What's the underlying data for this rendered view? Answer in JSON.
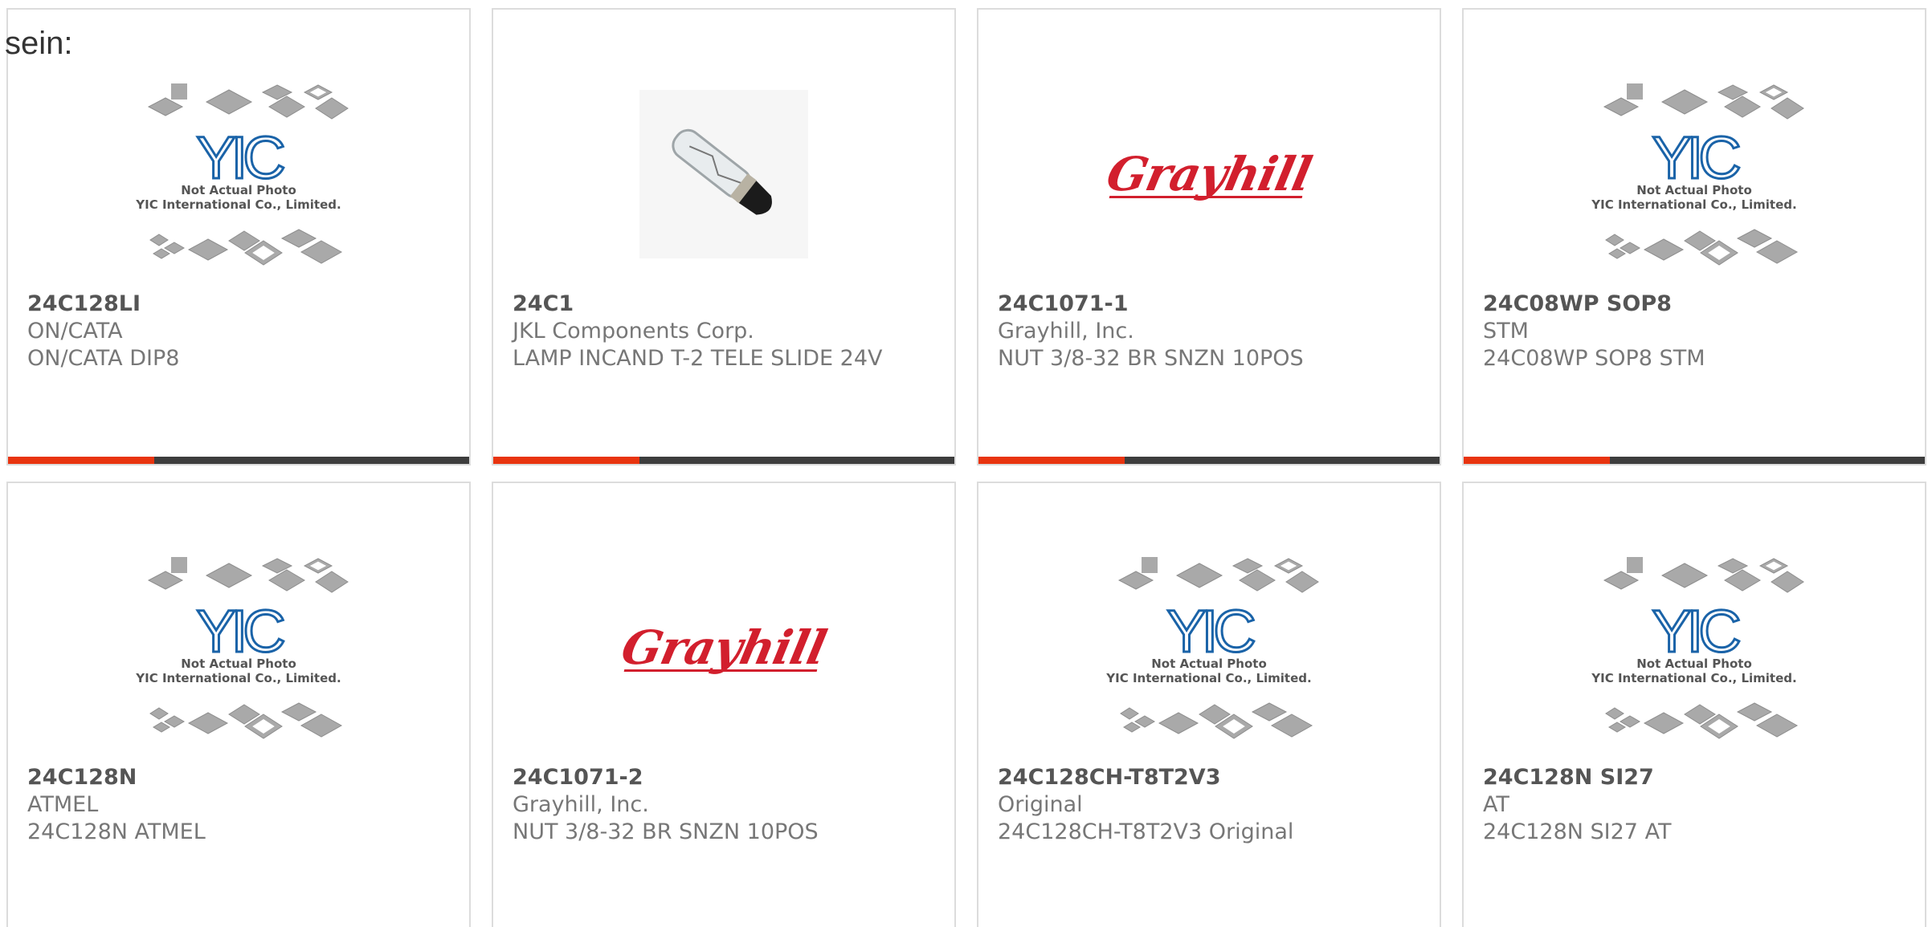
{
  "intro_text": "sein:",
  "colors": {
    "accent": "#e8340f",
    "bar": "#3d3d3d",
    "yic_blue": "#1a63a8",
    "grayhill_red": "#d21f2d",
    "chip_gray": "#a9a9a9"
  },
  "placeholder_image": {
    "brand": "YIC",
    "caption_line1": "Not Actual Photo",
    "caption_line2": "YIC International Co., Limited."
  },
  "grayhill_logo_text": "Grayhill",
  "products": [
    {
      "part_number": "24C128LI",
      "manufacturer": "ON/CATA",
      "description": "ON/CATA DIP8",
      "image": "yic-placeholder"
    },
    {
      "part_number": "24C1",
      "manufacturer": "JKL Components Corp.",
      "description": "LAMP INCAND T-2 TELE SLIDE 24V",
      "image": "lamp-photo"
    },
    {
      "part_number": "24C1071-1",
      "manufacturer": "Grayhill, Inc.",
      "description": "NUT 3/8-32 BR SNZN 10POS",
      "image": "grayhill-logo"
    },
    {
      "part_number": "24C08WP SOP8",
      "manufacturer": "STM",
      "description": "24C08WP SOP8 STM",
      "image": "yic-placeholder"
    },
    {
      "part_number": "24C128N",
      "manufacturer": "ATMEL",
      "description": "24C128N ATMEL",
      "image": "yic-placeholder"
    },
    {
      "part_number": "24C1071-2",
      "manufacturer": "Grayhill, Inc.",
      "description": "NUT 3/8-32 BR SNZN 10POS",
      "image": "grayhill-logo"
    },
    {
      "part_number": "24C128CH-T8T2V3",
      "manufacturer": "Original",
      "description": "24C128CH-T8T2V3 Original",
      "image": "yic-placeholder"
    },
    {
      "part_number": "24C128N SI27",
      "manufacturer": "AT",
      "description": "24C128N SI27 AT",
      "image": "yic-placeholder"
    }
  ]
}
